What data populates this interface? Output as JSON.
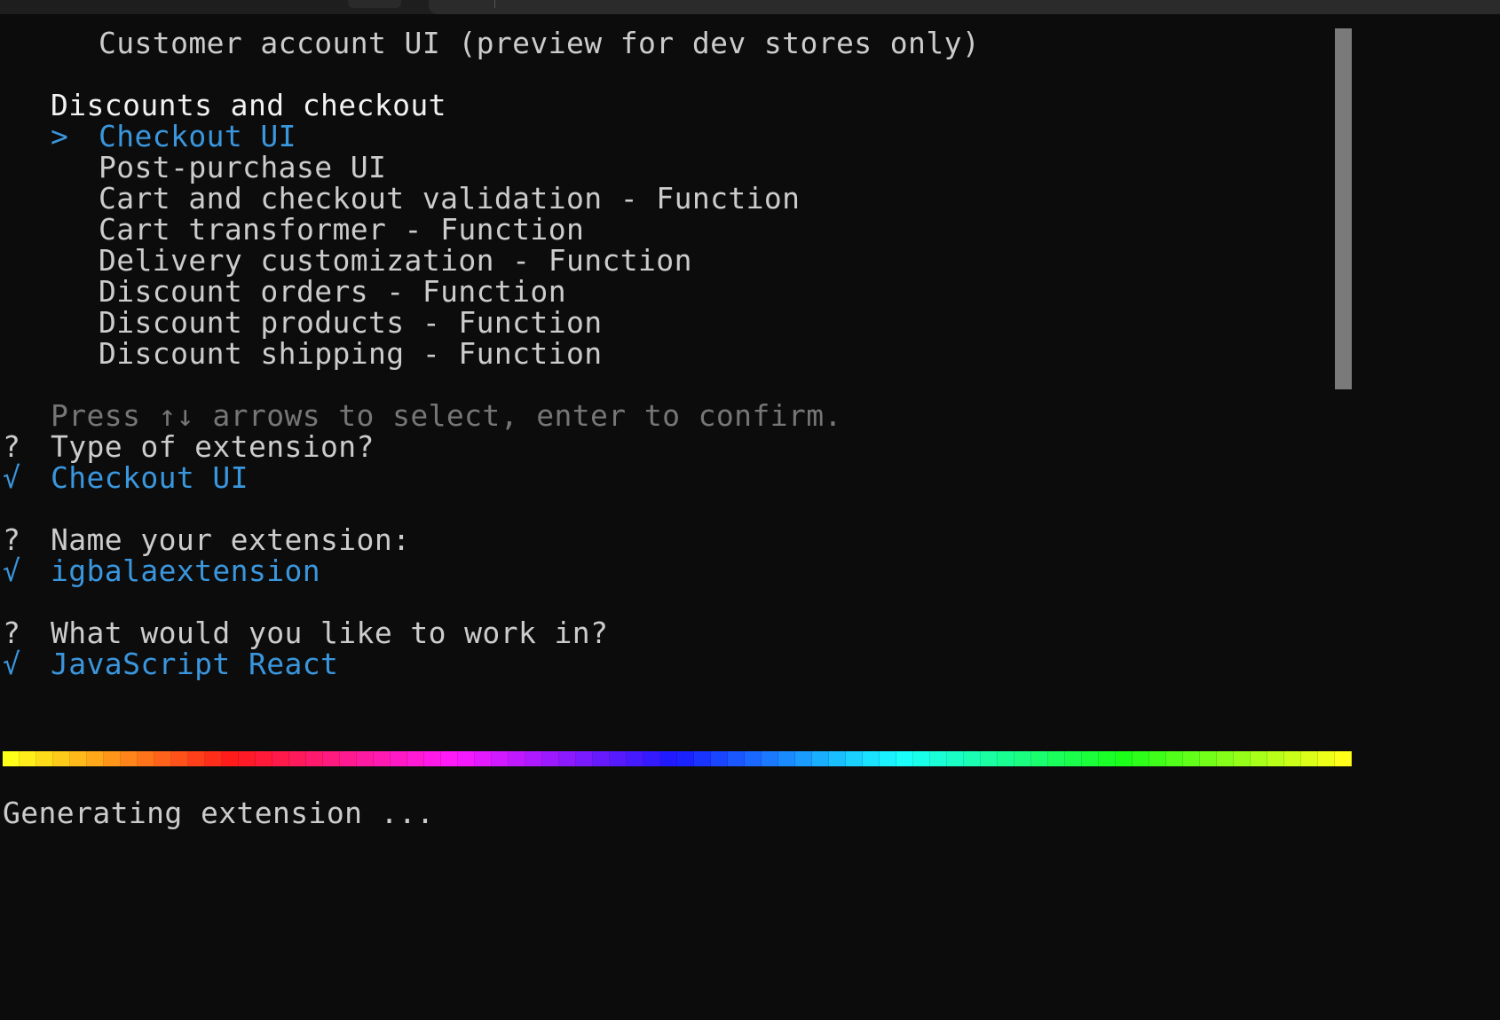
{
  "terminal": {
    "header_line": "Customer account UI (preview for dev stores only)",
    "section_title": "Discounts and checkout",
    "cursor": ">",
    "options": [
      {
        "label": "Checkout UI",
        "selected": true
      },
      {
        "label": "Post-purchase UI",
        "selected": false
      },
      {
        "label": "Cart and checkout validation - Function",
        "selected": false
      },
      {
        "label": "Cart transformer - Function",
        "selected": false
      },
      {
        "label": "Delivery customization - Function",
        "selected": false
      },
      {
        "label": "Discount orders - Function",
        "selected": false
      },
      {
        "label": "Discount products - Function",
        "selected": false
      },
      {
        "label": "Discount shipping - Function",
        "selected": false
      }
    ],
    "hint": "Press ↑↓ arrows to select, enter to confirm.",
    "prompts": [
      {
        "q_mark": "?",
        "question": "Type of extension?",
        "check": "√",
        "answer": "Checkout UI"
      },
      {
        "q_mark": "?",
        "question": "Name your extension:",
        "check": "√",
        "answer": "igbalaextension"
      },
      {
        "q_mark": "?",
        "question": "What would you like to work in?",
        "check": "√",
        "answer": "JavaScript React"
      }
    ],
    "status": "Generating extension ...",
    "progress": 1.0
  },
  "colors": {
    "background": "#0c0c0c",
    "text": "#cccccc",
    "accent_blue": "#3a96dd",
    "dim": "#767676"
  }
}
